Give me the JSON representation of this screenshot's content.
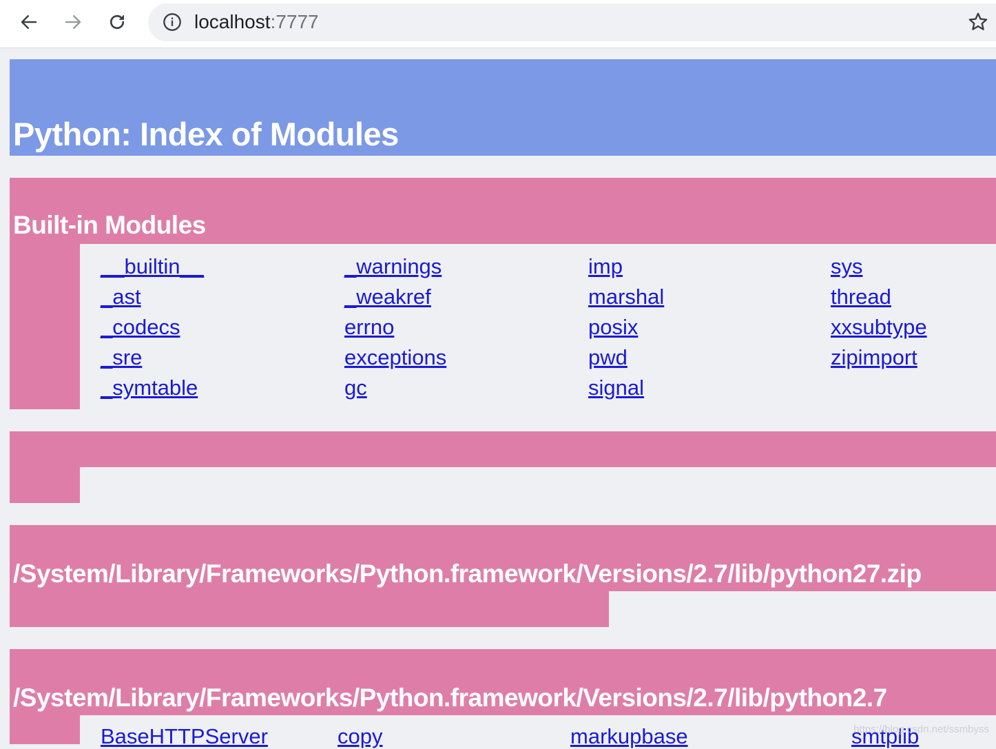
{
  "browser": {
    "url_host": "localhost",
    "url_port": ":7777"
  },
  "page": {
    "title": "Python: Index of Modules"
  },
  "builtin": {
    "title": "Built-in Modules",
    "columns": [
      [
        "__builtin__",
        "_ast",
        "_codecs",
        "_sre",
        "_symtable"
      ],
      [
        "_warnings",
        "_weakref",
        "errno",
        "exceptions",
        "gc"
      ],
      [
        "imp",
        "marshal",
        "posix",
        "pwd",
        "signal"
      ],
      [
        "sys",
        "thread",
        "xxsubtype",
        "zipimport"
      ]
    ]
  },
  "zip_section": {
    "title": "/System/Library/Frameworks/Python.framework/Versions/2.7/lib/python27.zip"
  },
  "lib_section": {
    "title": "/System/Library/Frameworks/Python.framework/Versions/2.7/lib/python2.7",
    "first_row": [
      "BaseHTTPServer",
      "copy",
      "markupbase",
      "smtplib"
    ]
  },
  "watermark": "https://blog.csdn.net/ssmbyss",
  "colors": {
    "title_bar": "#7c99e6",
    "section_bar": "#de7ea8",
    "link": "#1a1ad6",
    "page_bg": "#eff0f4"
  }
}
